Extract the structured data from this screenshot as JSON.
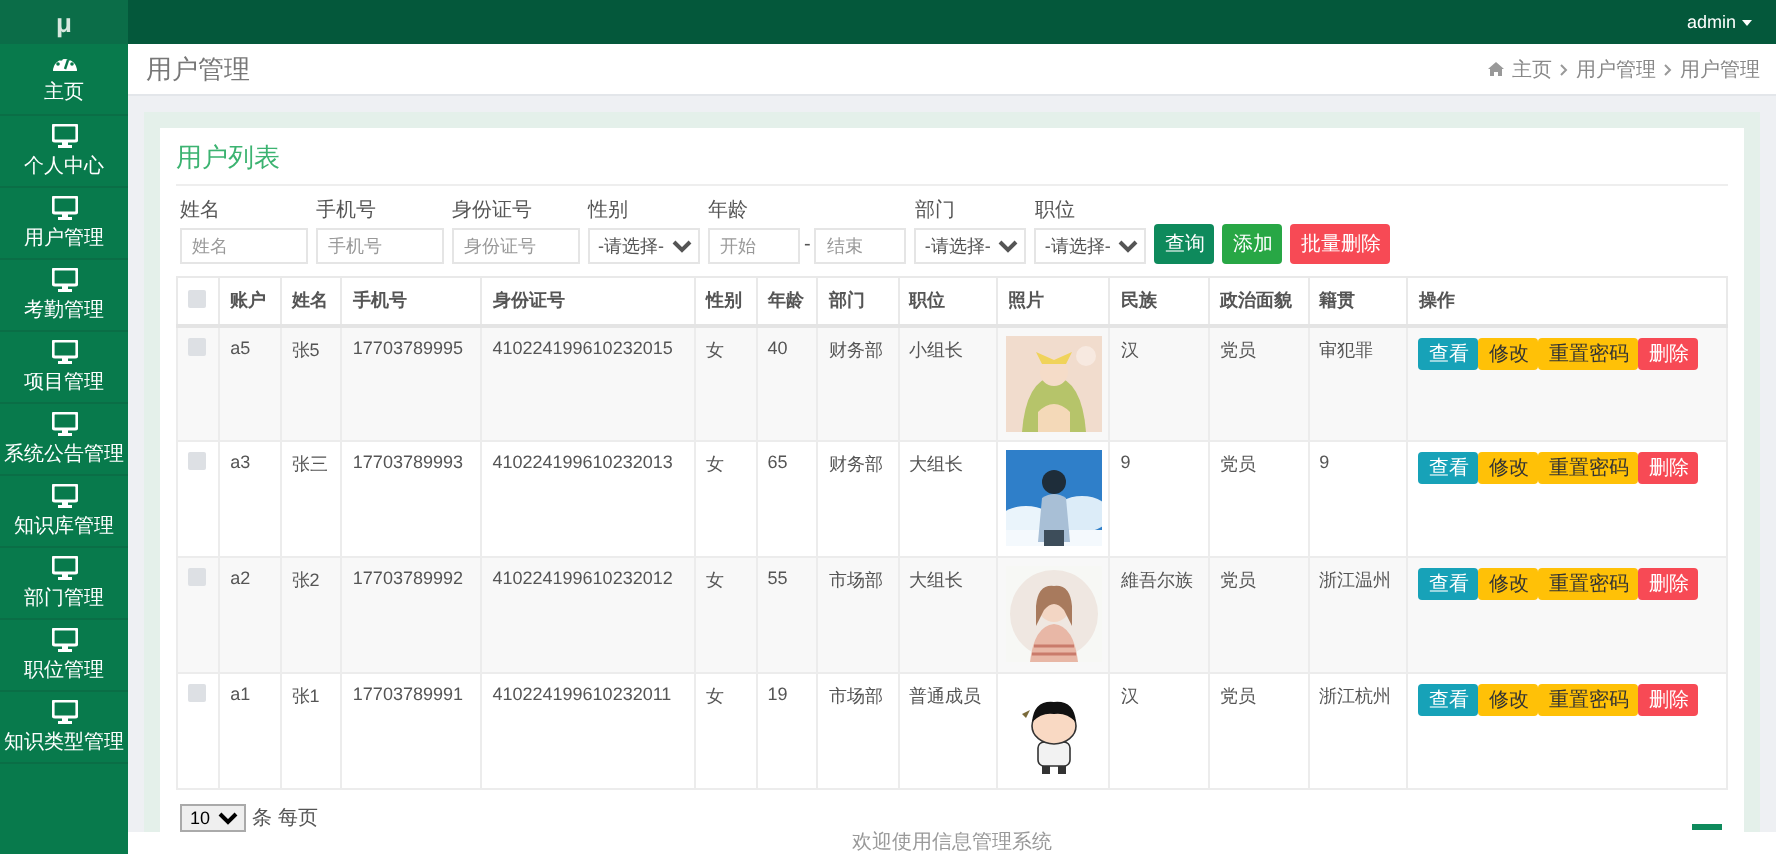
{
  "topbar": {
    "logo": "μ",
    "user": "admin"
  },
  "sidebar": {
    "items": [
      {
        "label": "主页"
      },
      {
        "label": "个人中心"
      },
      {
        "label": "用户管理"
      },
      {
        "label": "考勤管理"
      },
      {
        "label": "项目管理"
      },
      {
        "label": "系统公告管理"
      },
      {
        "label": "知识库管理"
      },
      {
        "label": "部门管理"
      },
      {
        "label": "职位管理"
      },
      {
        "label": "知识类型管理"
      }
    ]
  },
  "header": {
    "title": "用户管理",
    "breadcrumb": [
      "主页",
      "用户管理",
      "用户管理"
    ]
  },
  "card": {
    "title": "用户列表"
  },
  "filters": [
    {
      "kind": "text",
      "label": "姓名",
      "placeholder": "姓名"
    },
    {
      "kind": "text",
      "label": "手机号",
      "placeholder": "手机号"
    },
    {
      "kind": "text",
      "label": "身份证号",
      "placeholder": "身份证号"
    },
    {
      "kind": "select",
      "label": "性别",
      "value": "-请选择-"
    },
    {
      "kind": "range",
      "label": "年龄",
      "from_placeholder": "开始",
      "separator": "-",
      "to_placeholder": "结束"
    },
    {
      "kind": "select",
      "label": "部门",
      "value": "-请选择-"
    },
    {
      "kind": "select",
      "label": "职位",
      "value": "-请选择-"
    }
  ],
  "actions": [
    {
      "label": "查询",
      "kind": "primary"
    },
    {
      "label": "添加",
      "kind": "success"
    },
    {
      "label": "批量删除",
      "kind": "danger"
    }
  ],
  "table": {
    "select_all_checked": false,
    "columns": [
      "账户",
      "姓名",
      "手机号",
      "身份证号",
      "性别",
      "年龄",
      "部门",
      "职位",
      "照片",
      "民族",
      "政治面貌",
      "籍贯",
      "操作"
    ],
    "rows": [
      {
        "checked": false,
        "cells": [
          "a5",
          "张5",
          "17703789995",
          "410224199610232015",
          "女",
          "40",
          "财务部",
          "小组长"
        ],
        "photo": {
          "kind": "picture"
        },
        "after": [
          "汉",
          "党员",
          "审犯罪"
        ],
        "actions": [
          {
            "label": "查看",
            "kind": "info"
          },
          {
            "label": "修改",
            "kind": "warning"
          },
          {
            "label": "重置密码",
            "kind": "warning"
          },
          {
            "label": "删除",
            "kind": "danger"
          }
        ]
      },
      {
        "checked": false,
        "cells": [
          "a3",
          "张三",
          "17703789993",
          "410224199610232013",
          "女",
          "65",
          "财务部",
          "大组长"
        ],
        "photo": {
          "kind": "picture"
        },
        "after": [
          "9",
          "党员",
          "9"
        ],
        "actions": [
          {
            "label": "查看",
            "kind": "info"
          },
          {
            "label": "修改",
            "kind": "warning"
          },
          {
            "label": "重置密码",
            "kind": "warning"
          },
          {
            "label": "删除",
            "kind": "danger"
          }
        ]
      },
      {
        "checked": false,
        "cells": [
          "a2",
          "张2",
          "17703789992",
          "410224199610232012",
          "女",
          "55",
          "市场部",
          "大组长"
        ],
        "photo": {
          "kind": "picture"
        },
        "after": [
          "維吾尔族",
          "党员",
          "浙江温州"
        ],
        "actions": [
          {
            "label": "查看",
            "kind": "info"
          },
          {
            "label": "修改",
            "kind": "warning"
          },
          {
            "label": "重置密码",
            "kind": "warning"
          },
          {
            "label": "删除",
            "kind": "danger"
          }
        ]
      },
      {
        "checked": false,
        "cells": [
          "a1",
          "张1",
          "17703789991",
          "410224199610232011",
          "女",
          "19",
          "市场部",
          "普通成员"
        ],
        "photo": {
          "kind": "picture"
        },
        "after": [
          "汉",
          "党员",
          "浙江杭州"
        ],
        "actions": [
          {
            "label": "查看",
            "kind": "info"
          },
          {
            "label": "修改",
            "kind": "warning"
          },
          {
            "label": "重置密码",
            "kind": "warning"
          },
          {
            "label": "删除",
            "kind": "danger"
          }
        ]
      }
    ]
  },
  "pagination": {
    "page_size": "10",
    "suffix": "条 每页"
  },
  "footer": "欢迎使用信息管理系统"
}
